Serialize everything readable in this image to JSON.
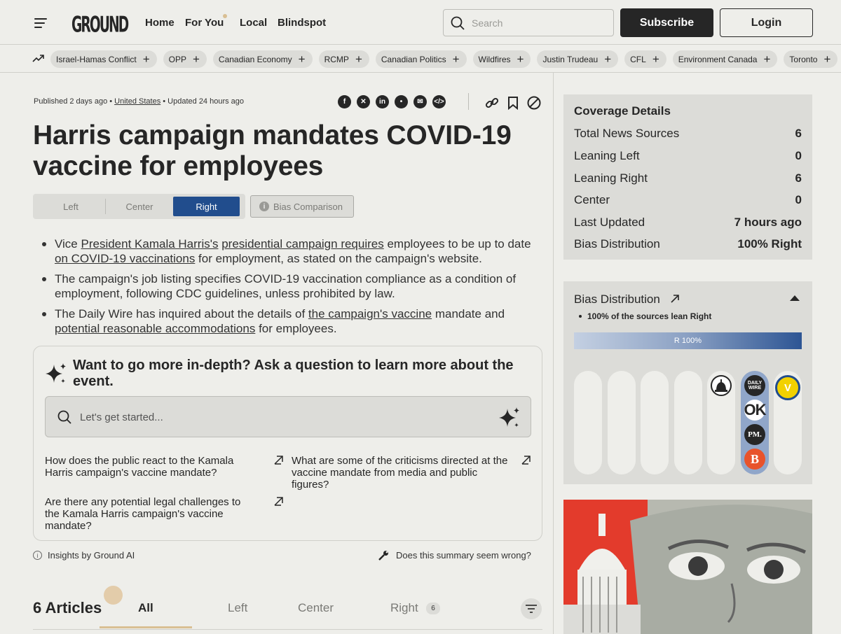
{
  "header": {
    "logo": "GROUND",
    "nav": [
      "Home",
      "For You",
      "Local",
      "Blindspot"
    ],
    "search_placeholder": "Search",
    "subscribe": "Subscribe",
    "login": "Login"
  },
  "topics": [
    "Israel-Hamas Conflict",
    "OPP",
    "Canadian Economy",
    "RCMP",
    "Canadian Politics",
    "Wildfires",
    "Justin Trudeau",
    "CFL",
    "Environment Canada",
    "Toronto"
  ],
  "article": {
    "published": "Published 2 days ago",
    "location": "United States",
    "updated": "Updated 24 hours ago",
    "title": "Harris campaign mandates COVID-19 vaccine for employees",
    "segments": [
      "Left",
      "Center",
      "Right"
    ],
    "active_segment": "Right",
    "bias_comparison": "Bias Comparison",
    "bullets": [
      {
        "a": "Vice ",
        "b": "President Kamala Harris's",
        "c": " ",
        "d": "presidential campaign requires",
        "e": " employees to be up to date ",
        "f": "on COVID-19 vaccinations",
        "g": " for employment, as stated on the campaign's website."
      },
      {
        "text": "The campaign's job listing specifies COVID-19 vaccination compliance as a condition of employment, following CDC guidelines, unless prohibited by law."
      },
      {
        "a": "The Daily Wire has inquired about the details of ",
        "b": "the campaign's vaccine",
        "c": " mandate and ",
        "d": "potential reasonable accommodations",
        "e": " for employees."
      }
    ]
  },
  "ask": {
    "heading": "Want to go more in-depth? Ask a question to learn more about the event.",
    "placeholder": "Let's get started...",
    "questions": [
      "How does the public react to the Kamala Harris campaign's vaccine mandate?",
      "What are some of the criticisms directed at the vaccine mandate from media and public figures?",
      "Are there any potential legal challenges to the Kamala Harris campaign's vaccine mandate?"
    ],
    "insights": "Insights by Ground AI",
    "wrong": "Does this summary seem wrong?"
  },
  "articles": {
    "count_label": "6 Articles",
    "tabs": [
      "All",
      "Left",
      "Center",
      "Right"
    ],
    "right_count": "6"
  },
  "coverage": {
    "title": "Coverage Details",
    "rows": [
      {
        "label": "Total News Sources",
        "value": "6"
      },
      {
        "label": "Leaning Left",
        "value": "0"
      },
      {
        "label": "Leaning Right",
        "value": "6"
      },
      {
        "label": "Center",
        "value": "0"
      },
      {
        "label": "Last Updated",
        "value": "7 hours ago"
      },
      {
        "label": "Bias Distribution",
        "value": "100% Right"
      }
    ]
  },
  "bias": {
    "title": "Bias Distribution",
    "summary": "100% of the sources lean Right",
    "bar_label": "R 100%",
    "right_share": 1.0,
    "sources": [
      "DAILY WIRE",
      "OK",
      "PM.",
      "B",
      "V"
    ]
  },
  "colors": {
    "background": "#eeeeea",
    "panel": "#dcdcd8",
    "right_blue": "#214d8d",
    "accent_gold": "#d9bf93",
    "text": "#262626"
  }
}
